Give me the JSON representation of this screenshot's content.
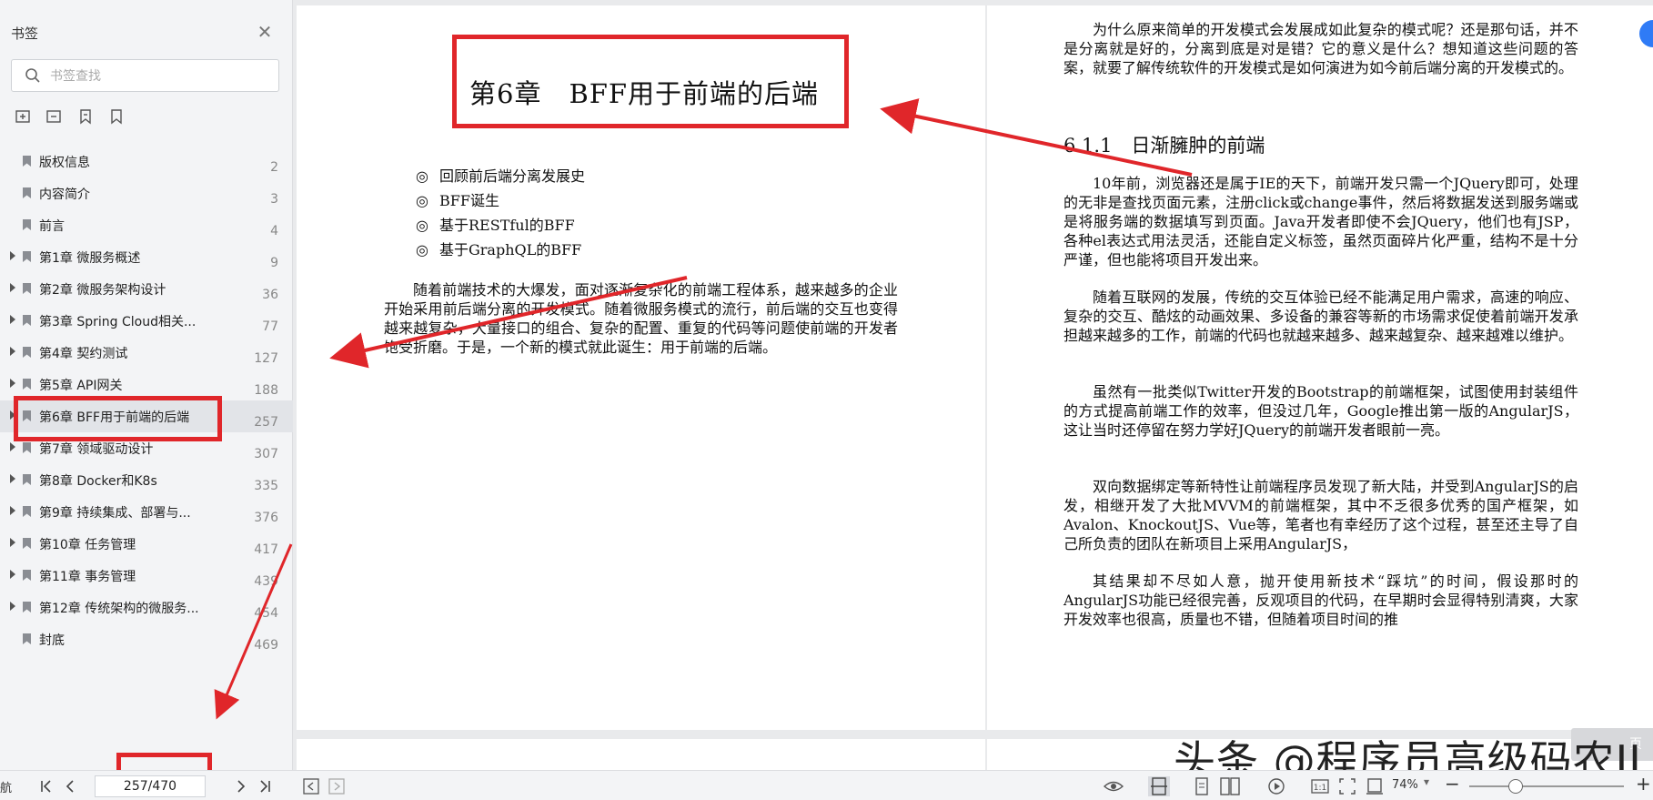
{
  "sidebar": {
    "title": "书签",
    "close_icon": "close-icon",
    "search_placeholder": "书签查找",
    "tools": [
      "expand-all-icon",
      "collapse-all-icon",
      "add-bookmark-icon",
      "bookmark-icon"
    ],
    "items": [
      {
        "label": "版权信息",
        "page": "2",
        "expandable": false
      },
      {
        "label": "内容简介",
        "page": "3",
        "expandable": false
      },
      {
        "label": "前言",
        "page": "4",
        "expandable": false
      },
      {
        "label": "第1章 微服务概述",
        "page": "9",
        "expandable": true
      },
      {
        "label": "第2章 微服务架构设计",
        "page": "36",
        "expandable": true
      },
      {
        "label": "第3章 Spring Cloud相关...",
        "page": "77",
        "expandable": true
      },
      {
        "label": "第4章 契约测试",
        "page": "127",
        "expandable": true
      },
      {
        "label": "第5章 API网关",
        "page": "188",
        "expandable": true
      },
      {
        "label": "第6章 BFF用于前端的后端",
        "page": "257",
        "expandable": true,
        "active": true
      },
      {
        "label": "第7章 领域驱动设计",
        "page": "307",
        "expandable": true
      },
      {
        "label": "第8章 Docker和K8s",
        "page": "335",
        "expandable": true
      },
      {
        "label": "第9章 持续集成、部署与...",
        "page": "376",
        "expandable": true
      },
      {
        "label": "第10章 任务管理",
        "page": "417",
        "expandable": true
      },
      {
        "label": "第11章 事务管理",
        "page": "439",
        "expandable": true
      },
      {
        "label": "第12章 传统架构的微服务...",
        "page": "454",
        "expandable": true
      },
      {
        "label": "封底",
        "page": "469",
        "expandable": false
      }
    ]
  },
  "left_page": {
    "chapter_title": "第6章　BFF用于前端的后端",
    "toc_bullet": "◎",
    "toc": [
      "回顾前后端分离发展史",
      "BFF诞生",
      "基于RESTful的BFF",
      "基于GraphQL的BFF"
    ],
    "intro": "随着前端技术的大爆发，面对逐渐复杂化的前端工程体系，越来越多的企业开始采用前后端分离的开发模式。随着微服务模式的流行，前后端的交互也变得越来越复杂，大量接口的组合、复杂的配置、重复的代码等问题使前端的开发者饱受折磨。于是，一个新的模式就此诞生：用于前端的后端。"
  },
  "right_page": {
    "para0": "为什么原来简单的开发模式会发展成如此复杂的模式呢？还是那句话，并不是分离就是好的，分离到底是对是错？它的意义是什么？想知道这些问题的答案，就要了解传统软件的开发模式是如何演进为如今前后端分离的开发模式的。",
    "heading": "6.1.1　日渐臃肿的前端",
    "para1": "10年前，浏览器还是属于IE的天下，前端开发只需一个JQuery即可，处理的无非是查找页面元素，注册click或change事件，然后将数据发送到服务端或是将服务端的数据填写到页面。Java开发者即使不会JQuery，他们也有JSP，各种el表达式用法灵活，还能自定义标签，虽然页面碎片化严重，结构不是十分严谨，但也能将项目开发出来。",
    "para2": "随着互联网的发展，传统的交互体验已经不能满足用户需求，高速的响应、复杂的交互、酷炫的动画效果、多设备的兼容等新的市场需求促使着前端开发承担越来越多的工作，前端的代码也就越来越多、越来越复杂、越来越难以维护。",
    "para3": "虽然有一批类似Twitter开发的Bootstrap的前端框架，试图使用封装组件的方式提高前端工作的效率，但没过几年，Google推出第一版的AngularJS，这让当时还停留在努力学好JQuery的前端开发者眼前一亮。",
    "para4": "双向数据绑定等新特性让前端程序员发现了新大陆，并受到AngularJS的启发，相继开发了大批MVVM的前端框架，其中不乏很多优秀的国产框架，如Avalon、KnockoutJS、Vue等，笔者也有幸经历了这个过程，甚至还主导了自己所负责的团队在新项目上采用AngularJS，",
    "para5": "其结果却不尽如人意，抛开使用新技术“踩坑”的时间，假设那时的AngularJS功能已经很完善，反观项目的代码，在早期时会显得特别清爽，大家开发效率也很高，质量也不错，但随着项目时间的推"
  },
  "toolbar": {
    "left_cut_text": "航",
    "page_indicator": "257/470",
    "zoom_percent": "74%",
    "zoom_level": 0.3,
    "side_tab_text": "页"
  },
  "watermark": "头条 @程序员高级码农II",
  "colors": {
    "annotation_red": "#e0262a",
    "active_item_bg": "#e2e4e8",
    "sidebar_bg": "#f3f4f6"
  }
}
